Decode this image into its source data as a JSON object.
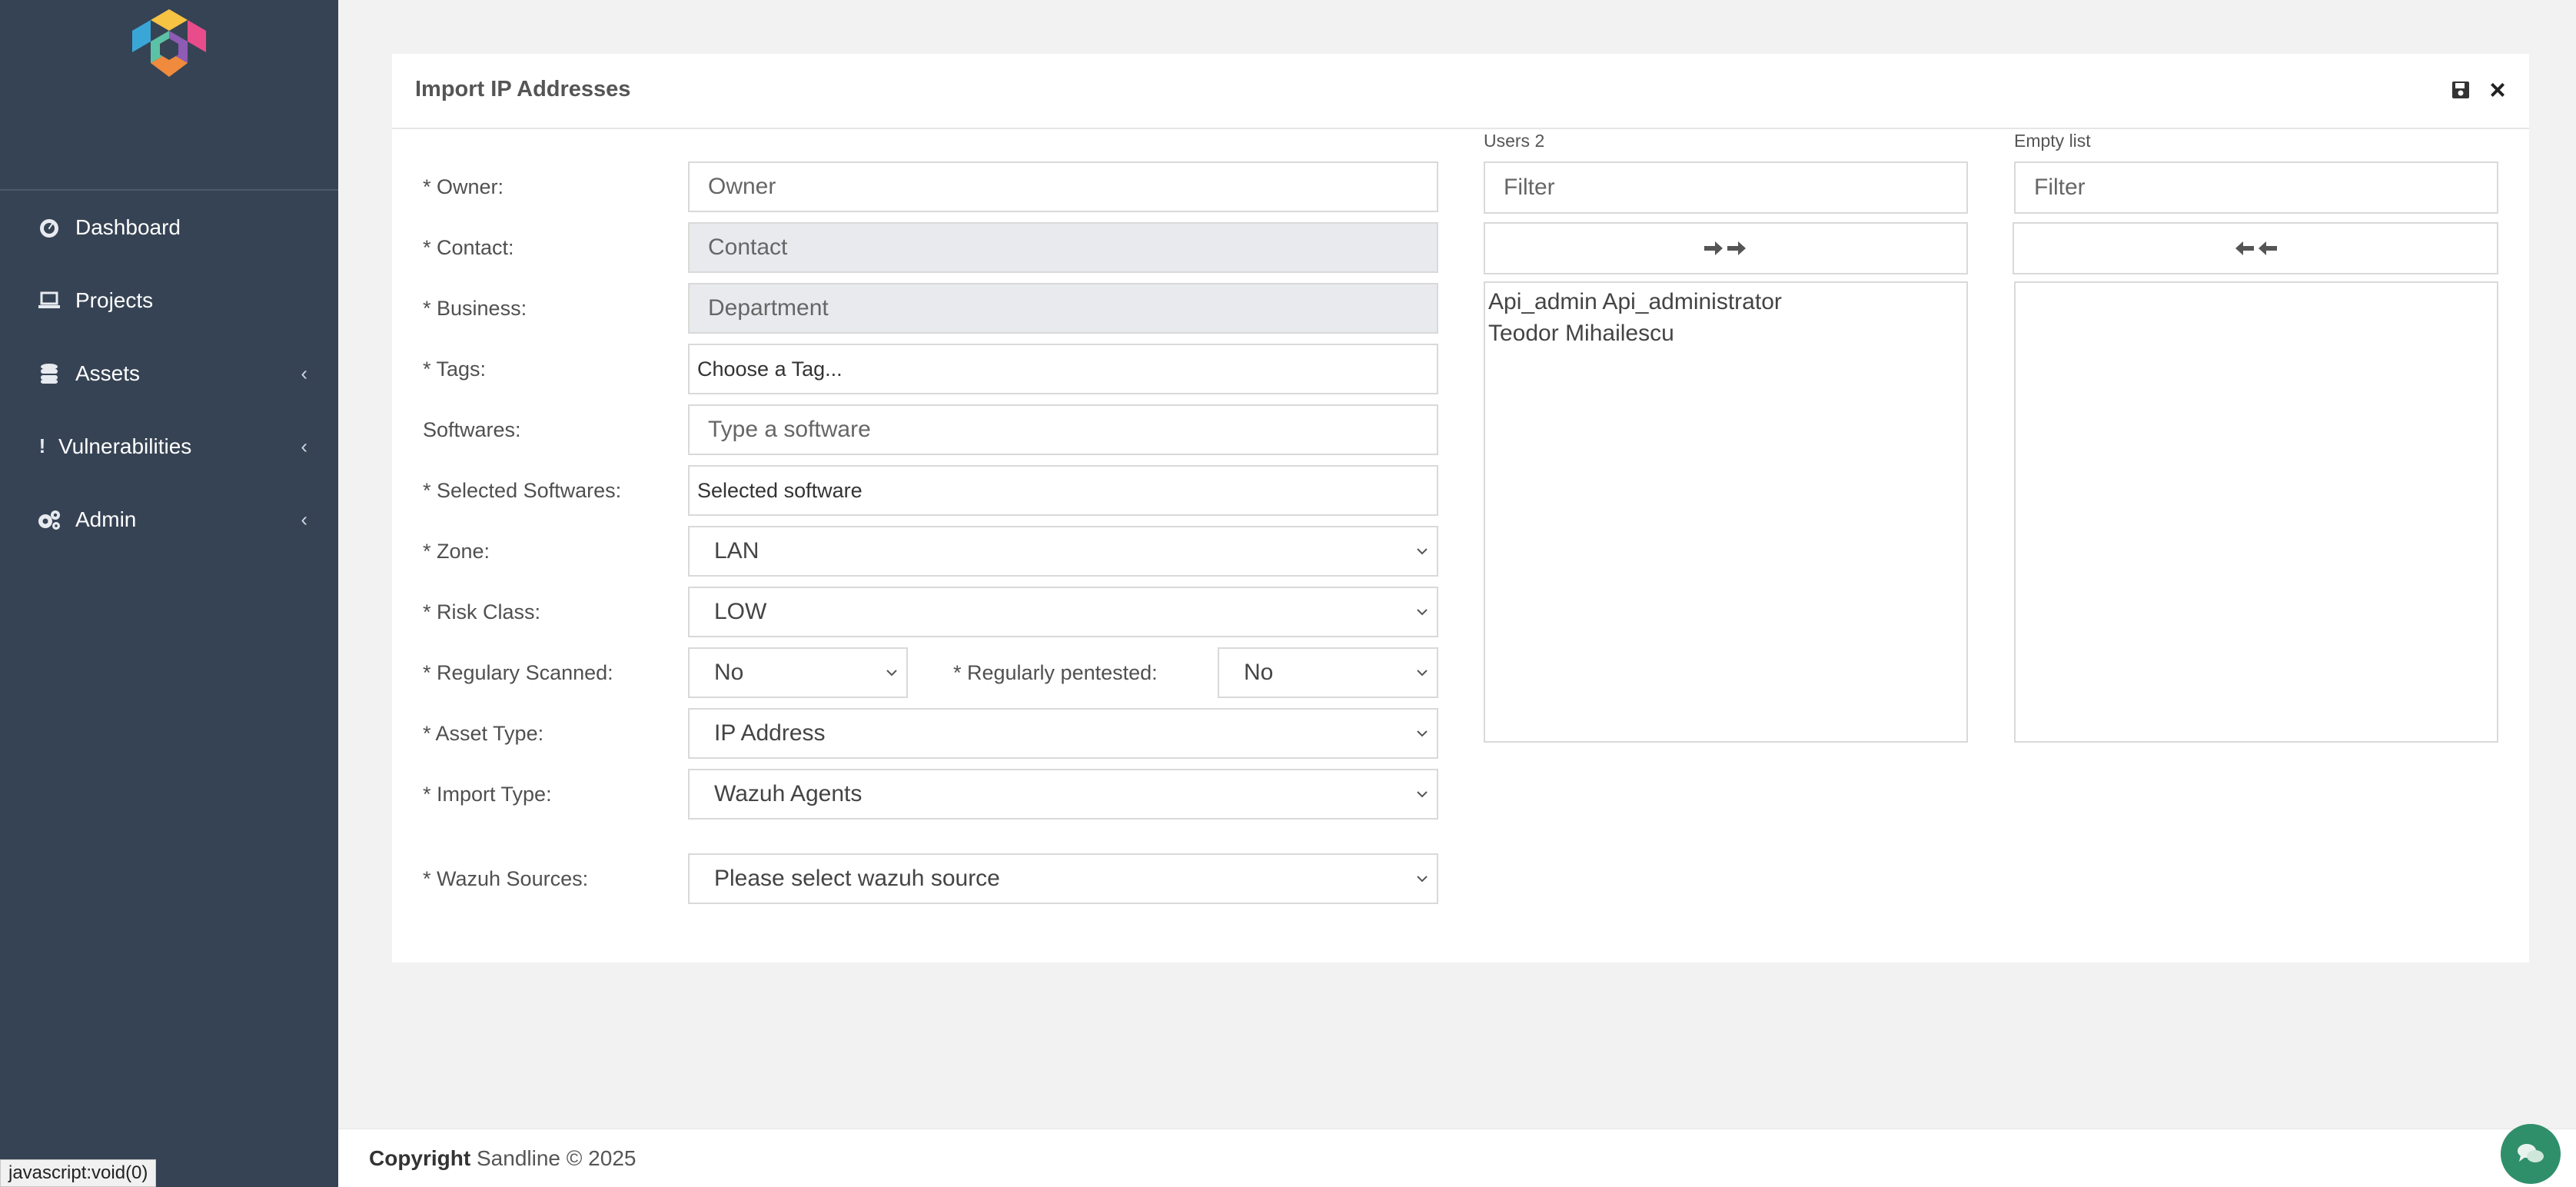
{
  "sidebar": {
    "items": [
      {
        "label": "Dashboard",
        "icon": "dashboard-icon"
      },
      {
        "label": "Projects",
        "icon": "laptop-icon"
      },
      {
        "label": "Assets",
        "icon": "database-icon"
      },
      {
        "label": "Vulnerabilities",
        "icon": "exclamation-icon"
      },
      {
        "label": "Admin",
        "icon": "cogs-icon"
      }
    ]
  },
  "modal": {
    "title": "Import IP Addresses",
    "labels": {
      "owner": "* Owner:",
      "contact": "* Contact:",
      "business": "* Business:",
      "tags": "* Tags:",
      "softwares": "Softwares:",
      "selected_softwares": "* Selected Softwares:",
      "zone": "* Zone:",
      "risk_class": "* Risk Class:",
      "regularly_scanned": "* Regulary Scanned:",
      "regularly_pentested": "* Regularly pentested:",
      "asset_type": "* Asset Type:",
      "import_type": "* Import Type:",
      "wazuh_sources": "* Wazuh Sources:"
    },
    "placeholders": {
      "owner": "Owner",
      "contact": "Contact",
      "business": "Department",
      "tags": "Choose a Tag...",
      "softwares": "Type a software",
      "selected_softwares": "Selected software"
    },
    "selects": {
      "zone": "LAN",
      "risk_class": "LOW",
      "regularly_scanned": "No",
      "regularly_pentested": "No",
      "asset_type": "IP Address",
      "import_type": "Wazuh Agents",
      "wazuh_sources": "Please select wazuh source"
    },
    "dual_list": {
      "left_label": "Users 2",
      "right_label": "Empty list",
      "filter_placeholder": "Filter",
      "left_items": [
        "Api_admin Api_administrator",
        "Teodor Mihailescu"
      ],
      "right_items": []
    }
  },
  "footer": {
    "copyright_label": "Copyright",
    "copyright_text": "Sandline © 2025"
  },
  "statusbar": "javascript:void(0)"
}
